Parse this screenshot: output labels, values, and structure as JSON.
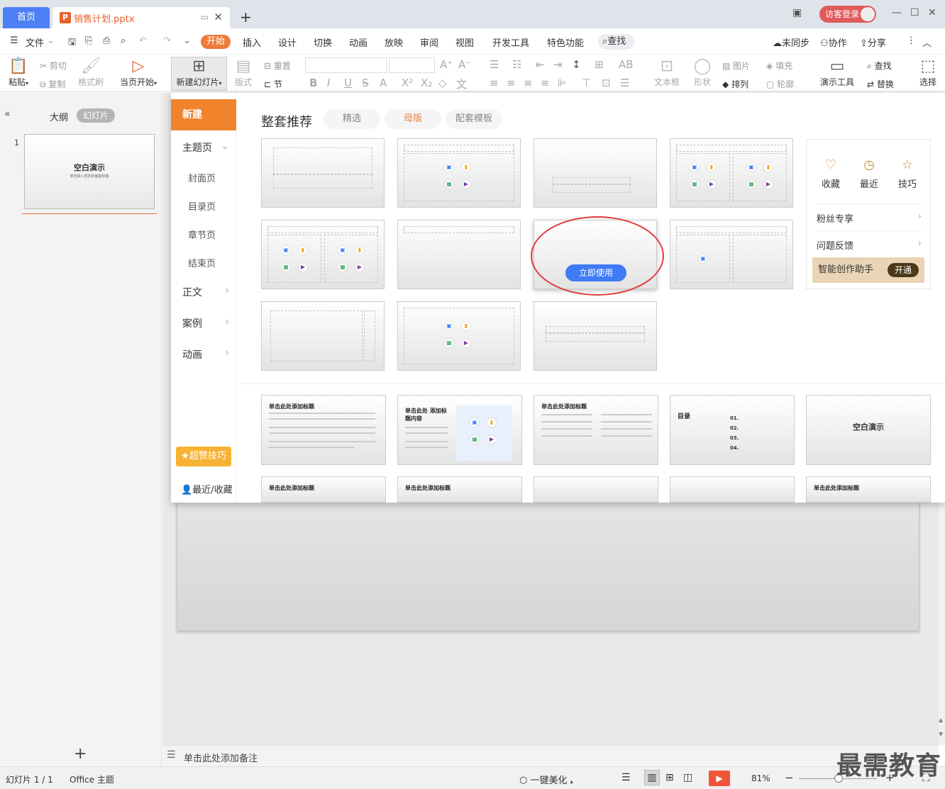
{
  "tabs": {
    "home": "首页",
    "doc_name": "销售计划.pptx"
  },
  "account": {
    "guest_label": "访客登录"
  },
  "menu": {
    "file": "文件",
    "items": [
      "开始",
      "插入",
      "设计",
      "切换",
      "动画",
      "放映",
      "审阅",
      "视图",
      "开发工具",
      "特色功能"
    ],
    "search": "查找",
    "sync": "未同步",
    "collab": "协作",
    "share": "分享"
  },
  "ribbon": {
    "paste": "粘贴",
    "cut": "剪切",
    "copy": "复制",
    "format_painter": "格式刷",
    "from_current": "当页开始",
    "new_slide": "新建幻灯片",
    "layout": "版式",
    "reset": "重置",
    "section": "节",
    "text_box": "文本框",
    "shape": "形状",
    "picture": "图片",
    "fill": "填充",
    "arrange": "排列",
    "outline": "轮廓",
    "present_tools": "演示工具",
    "find": "查找",
    "replace": "替换",
    "select": "选择"
  },
  "left_pane": {
    "outline_tab": "大纲",
    "slides_tab": "幻灯片",
    "slide_number": "1",
    "thumb_title": "空白演示",
    "thumb_subtitle": "单击输入您的封面副标题"
  },
  "panel": {
    "nav_new": "新建",
    "nav_items": [
      {
        "label": "主题页"
      },
      {
        "label": "正文"
      },
      {
        "label": "案例"
      },
      {
        "label": "动画"
      }
    ],
    "nav_sub": [
      "封面页",
      "目录页",
      "章节页",
      "结束页"
    ],
    "tips": "超赞技巧",
    "recent": "最近/收藏",
    "title": "整套推荐",
    "chips": [
      "精选",
      "母版",
      "配套模板"
    ],
    "use_now": "立即使用",
    "side": {
      "favorite": "收藏",
      "recent": "最近",
      "tips": "技巧",
      "fans": "粉丝专享",
      "feedback": "问题反馈",
      "assistant": "智能创作助手",
      "open": "开通"
    },
    "templates": [
      {
        "title": "单击此处添加标题"
      },
      {
        "title": "单击此处 添加标题内容"
      },
      {
        "title": "单击此处添加标题"
      },
      {
        "title": "目录"
      },
      {
        "title": "空白演示"
      }
    ],
    "toc_items": [
      "01.",
      "02.",
      "03.",
      "04."
    ],
    "row3_titles": [
      "单击此处添加标题",
      "单击此处添加标题",
      "单击此处添加标题"
    ]
  },
  "notes": {
    "placeholder": "单击此处添加备注"
  },
  "status": {
    "slide_info": "幻灯片 1 / 1",
    "theme": "Office 主题",
    "beautify": "一键美化",
    "zoom": "81%"
  },
  "watermark": "最需教育",
  "colors": {
    "accent_orange": "#f07a3a",
    "home_tab_blue": "#4d7ff5",
    "use_button_blue": "#3e7bf5",
    "annotation_red": "#e03c3c"
  }
}
